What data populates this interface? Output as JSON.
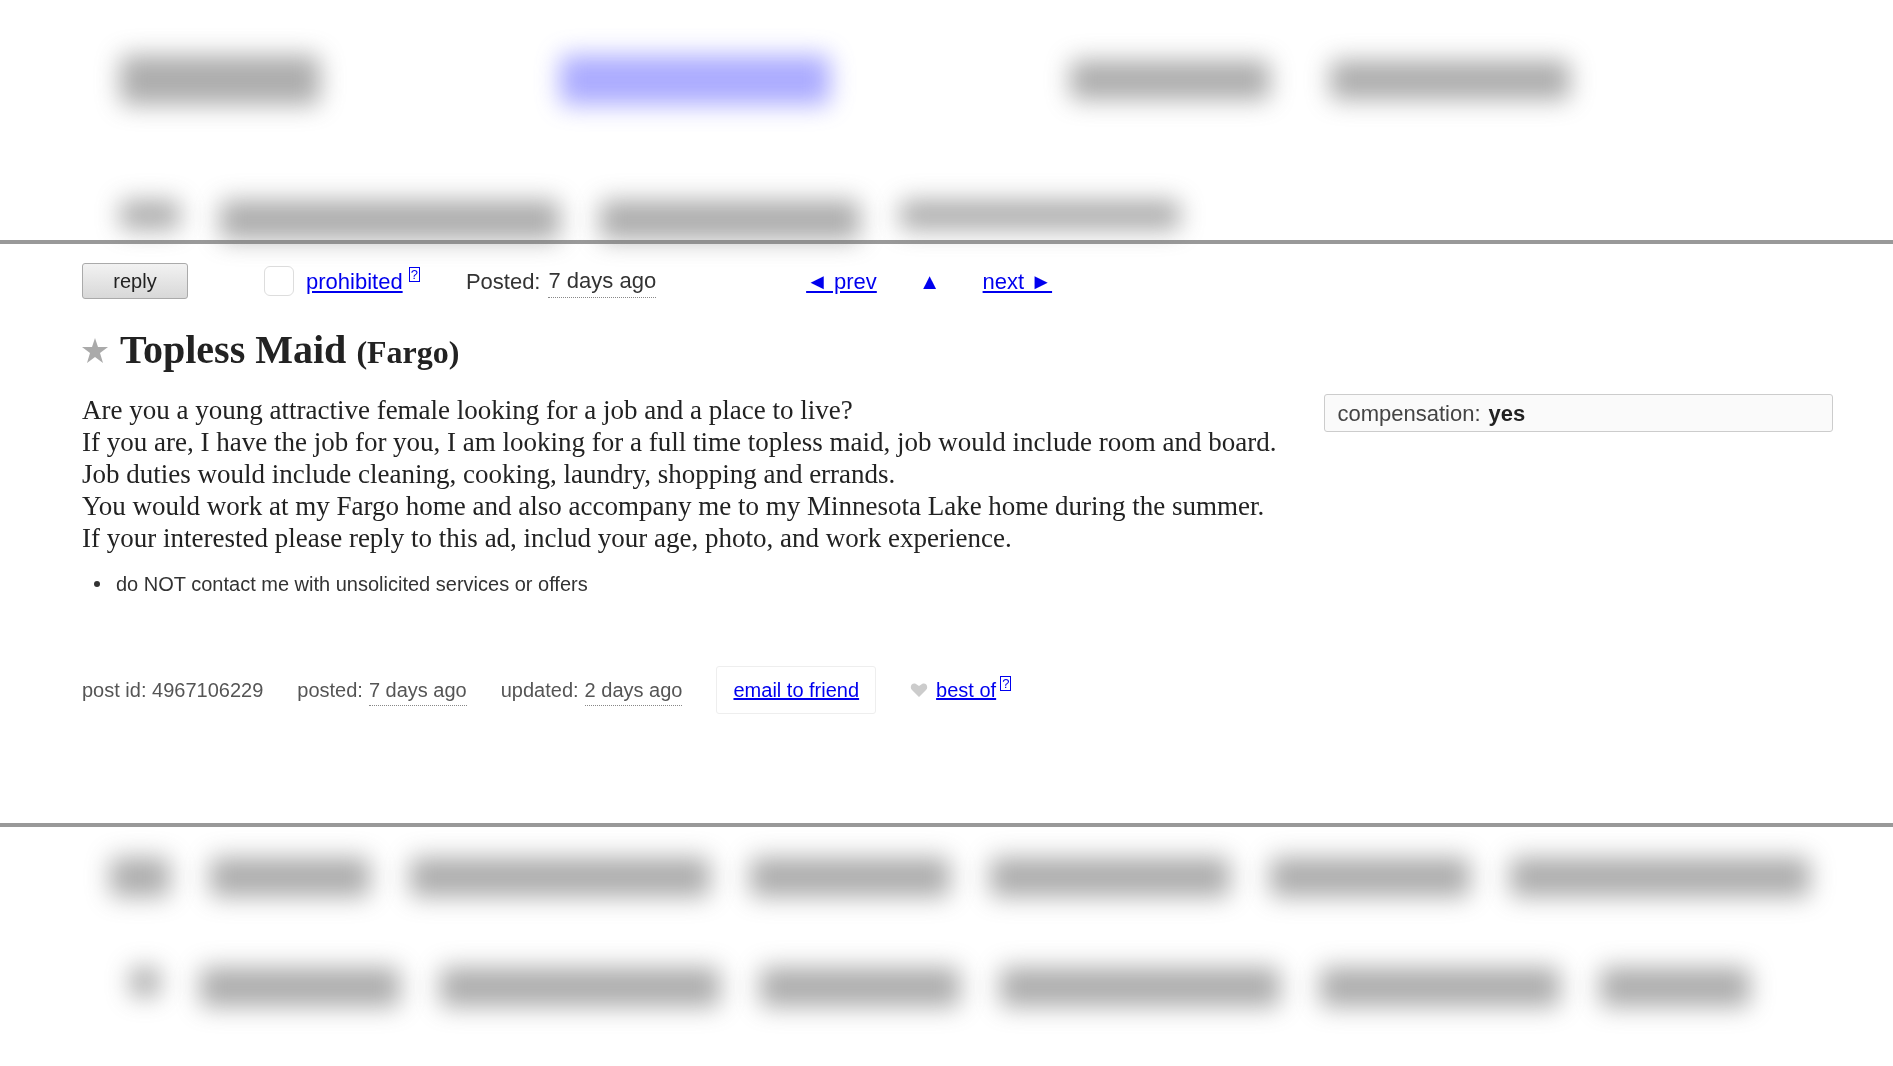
{
  "toolbar": {
    "reply": "reply",
    "flag": {
      "label": "prohibited",
      "help": "?",
      "checked": false
    },
    "posted_label": "Posted:",
    "posted": "7 days ago",
    "prev": "◄ prev",
    "up": "▲",
    "next": "next ►"
  },
  "post": {
    "favorite": false,
    "title": "Topless Maid",
    "location": "(Fargo)",
    "body": [
      "Are you a young attractive female looking for a job and a place to live?",
      "If you are, I have the job for you, I am looking for a full time topless maid, job would include room and board.",
      "Job duties would include cleaning, cooking, laundry, shopping and errands.",
      "You would work at my Fargo home and also accompany me to my Minnesota Lake home during the summer.",
      "If your interested please reply to this ad, includ your age, photo, and work experience."
    ],
    "attributes": [
      {
        "label": "compensation:",
        "value": "yes"
      }
    ],
    "notices": [
      "do NOT contact me with unsolicited services or offers"
    ]
  },
  "footer": {
    "post_id": "post id: 4967106229",
    "posted_label": "posted:",
    "posted": "7 days ago",
    "updated_label": "updated:",
    "updated": "2 days ago",
    "email": "email to friend",
    "best_of": "best of",
    "help": "?"
  }
}
